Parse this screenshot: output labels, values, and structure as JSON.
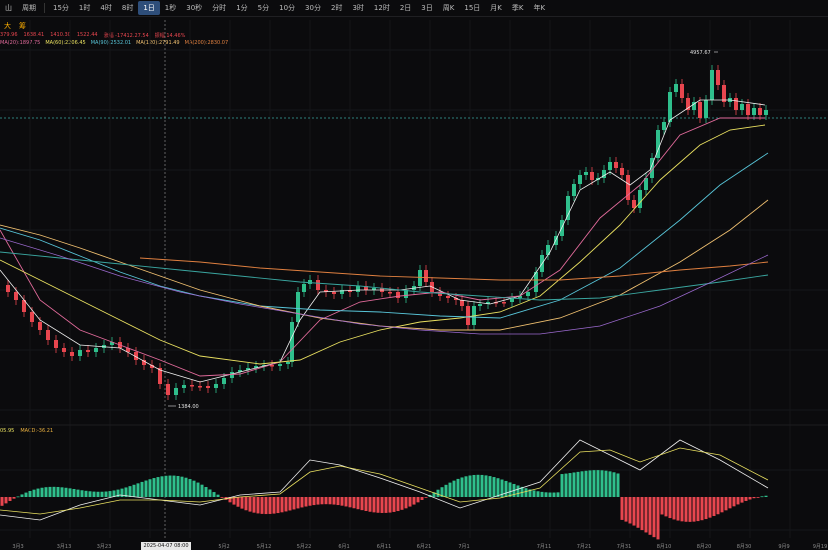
{
  "toolbar": {
    "items": [
      {
        "label": "山",
        "active": false
      },
      {
        "label": "周期",
        "active": false
      },
      {
        "label": "15分",
        "active": false
      },
      {
        "label": "1时",
        "active": false
      },
      {
        "label": "4时",
        "active": false
      },
      {
        "label": "8时",
        "active": false
      },
      {
        "label": "1日",
        "active": true
      },
      {
        "label": "1秒",
        "active": false
      },
      {
        "label": "30秒",
        "active": false
      },
      {
        "label": "分时",
        "active": false
      },
      {
        "label": "1分",
        "active": false
      },
      {
        "label": "5分",
        "active": false
      },
      {
        "label": "10分",
        "active": false
      },
      {
        "label": "30分",
        "active": false
      },
      {
        "label": "2时",
        "active": false
      },
      {
        "label": "3时",
        "active": false
      },
      {
        "label": "12时",
        "active": false
      },
      {
        "label": "2日",
        "active": false
      },
      {
        "label": "3日",
        "active": false
      },
      {
        "label": "周K",
        "active": false
      },
      {
        "label": "15日",
        "active": false
      },
      {
        "label": "月K",
        "active": false
      },
      {
        "label": "季K",
        "active": false
      },
      {
        "label": "年K",
        "active": false
      }
    ]
  },
  "tools": [
    "大",
    "筹"
  ],
  "info_values": [
    "379.96",
    "1638.41",
    "1410.30",
    "1522.44",
    "涨幅 -17412.27.54",
    "振幅 14.46%"
  ],
  "ma_labels": [
    {
      "text": "MA(20):1897.75",
      "color": "#e06a9a"
    },
    {
      "text": "MA(60):2206.45",
      "color": "#e9e060"
    },
    {
      "text": "MA(90):2532.01",
      "color": "#58c5d8"
    },
    {
      "text": "MA(120):2791.49",
      "color": "#f0c070"
    },
    {
      "text": "MA(200):2830.07",
      "color": "#e08040"
    }
  ],
  "macd_labels": [
    {
      "text": "05.95",
      "color": "#e9e060"
    },
    {
      "text": "MACD:-36.21",
      "color": "#e9b040"
    }
  ],
  "annotations": {
    "high": "4957.67",
    "low": "1384.00"
  },
  "crosshair_date": "2025-04-07 08:00",
  "x_labels": [
    "3月3",
    "3月13",
    "3月23",
    "4月22",
    "5月2",
    "5月12",
    "5月22",
    "6月1",
    "6月11",
    "6月21",
    "7月1",
    "7月11",
    "7月21",
    "7月31",
    "8月10",
    "8月20",
    "8月30",
    "9月9",
    "9月19"
  ],
  "chart_data": {
    "type": "candlestick",
    "high": 4957.67,
    "low": 1384.0,
    "crosshair": "2025-04-07 08:00",
    "series": [
      {
        "name": "MA(20)",
        "value": 1897.75
      },
      {
        "name": "MA(60)",
        "value": 2206.45
      },
      {
        "name": "MA(90)",
        "value": 2532.01
      },
      {
        "name": "MA(120)",
        "value": 2791.49
      },
      {
        "name": "MA(200)",
        "value": 2830.07
      }
    ]
  },
  "colors": {
    "up": "#2fbf8c",
    "down": "#e8464f",
    "bg": "#0b0b0d",
    "accent": "#2e4e7a"
  }
}
